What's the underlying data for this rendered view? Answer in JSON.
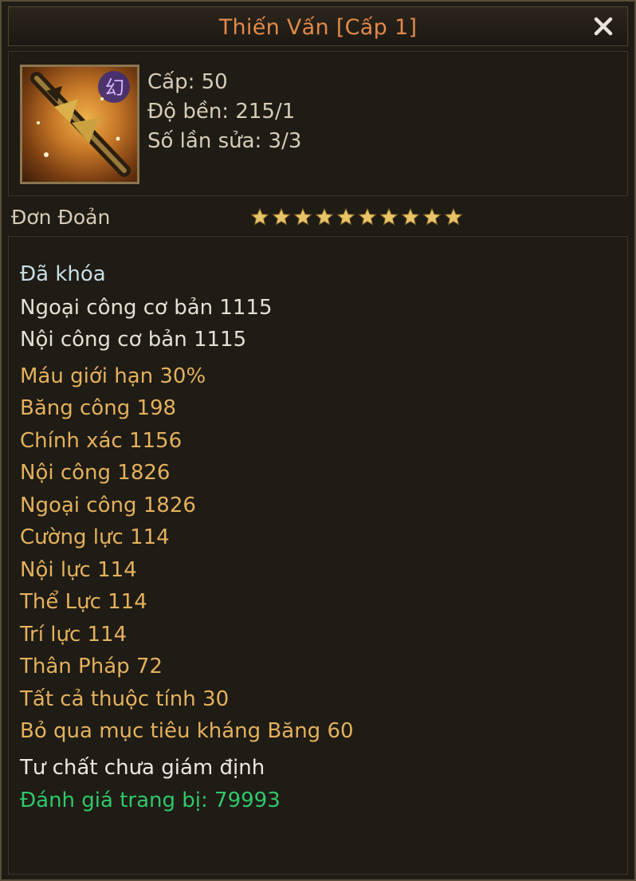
{
  "window": {
    "title": "Thiến Vấn [Cấp 1]",
    "close_icon": "close-icon"
  },
  "item": {
    "icon": "weapon-icon",
    "stats": [
      "Cấp: 50",
      "Độ bền: 215/1",
      "Số lần sửa: 3/3"
    ]
  },
  "grade": {
    "label": "Đơn Đoản",
    "stars": 10,
    "star_color": "#e8c468"
  },
  "status": {
    "locked": "Đã khóa"
  },
  "base_attributes": [
    "Ngoại công cơ bản 1115",
    "Nội công cơ bản 1115"
  ],
  "bonus_attributes": [
    "Máu giới hạn 30%",
    "Băng công 198",
    "Chính xác 1156",
    "Nội công 1826",
    "Ngoại công 1826",
    "Cường lực 114",
    "Nội lực 114",
    "Thể Lực 114",
    "Trí lực 114",
    "Thân Pháp 72",
    "Tất cả thuộc tính 30",
    "Bỏ qua mục tiêu kháng Băng 60"
  ],
  "aptitude": "Tư chất chưa giám định",
  "rating": "Đánh giá trang bị: 79993",
  "colors": {
    "title": "#e08a4a",
    "gold_text": "#e3b15c",
    "rating_text": "#2fc86a",
    "locked_text": "#c9dfe6"
  }
}
